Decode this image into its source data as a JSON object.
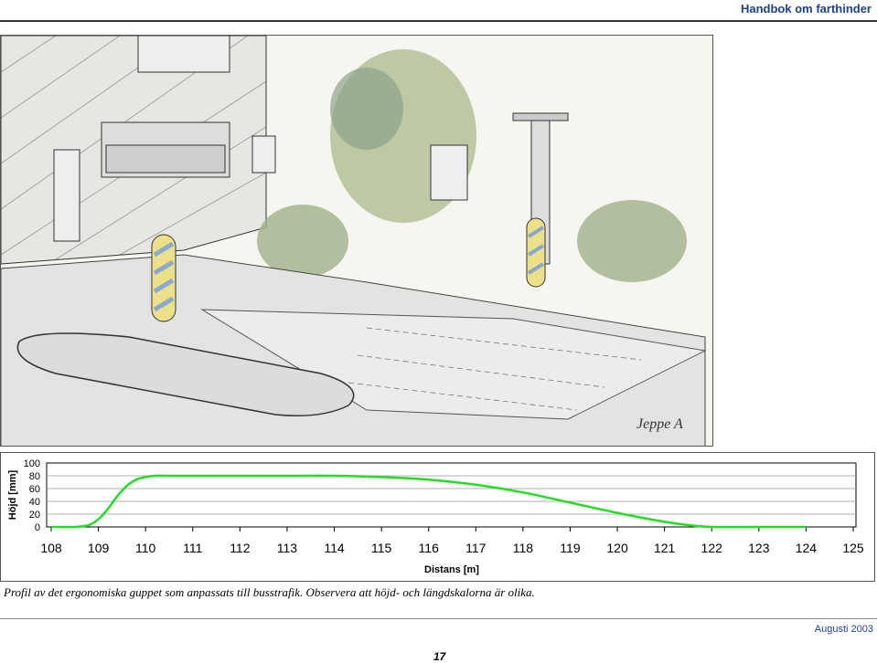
{
  "header": {
    "title": "Handbok om farthinder"
  },
  "illustration": {
    "signature": "Jeppe A"
  },
  "caption": "Profil av det ergonomiska guppet som anpassats till busstrafik. Observera att höjd- och längdskalorna är olika.",
  "footer": {
    "date": "Augusti 2003",
    "page_number": "17"
  },
  "colors": {
    "accent": "#1f3f8f",
    "series": "#22dd22",
    "plot_bg": "#ffffff",
    "grid": "#999999"
  },
  "chart_data": {
    "type": "line",
    "title": "",
    "xlabel": "Distans [m]",
    "ylabel": "Höjd [mm]",
    "xlim": [
      108,
      125
    ],
    "ylim": [
      0,
      100
    ],
    "x_ticks": [
      "108",
      "109",
      "110",
      "111",
      "112",
      "113",
      "114",
      "115",
      "116",
      "117",
      "118",
      "119",
      "120",
      "121",
      "122",
      "123",
      "124",
      "125"
    ],
    "y_ticks": [
      "100",
      "80",
      "60",
      "40",
      "20",
      "0"
    ],
    "grid": "horizontal",
    "series": [
      {
        "x": [
          108.0,
          108.5,
          108.8,
          109.0,
          109.2,
          109.4,
          109.6,
          109.8,
          110.0,
          110.2,
          110.4,
          111.0,
          112.0,
          113.0,
          114.0,
          115.0,
          116.0,
          117.0,
          118.0,
          119.0,
          120.0,
          121.0,
          121.5,
          122.0,
          123.0,
          124.0
        ],
        "y": [
          0,
          0,
          3,
          12,
          28,
          48,
          64,
          74,
          78,
          80,
          80,
          80,
          80,
          80,
          80,
          78,
          74,
          66,
          54,
          38,
          22,
          8,
          3,
          0,
          0,
          0
        ]
      }
    ]
  }
}
